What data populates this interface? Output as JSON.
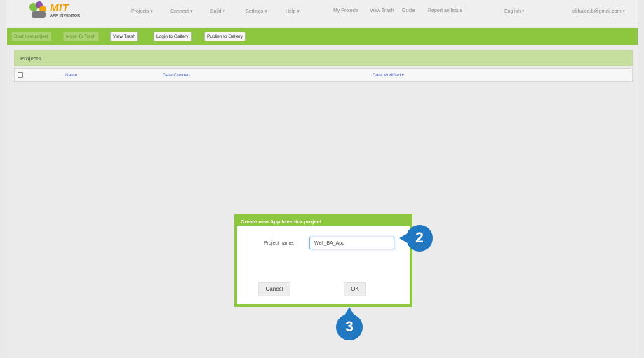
{
  "header": {
    "logo_title": "MIT",
    "logo_subtitle": "APP INVENTOR",
    "nav": [
      {
        "label": "Projects ▾"
      },
      {
        "label": "Connect ▾"
      },
      {
        "label": "Build ▾"
      },
      {
        "label": "Settings ▾"
      },
      {
        "label": "Help ▾"
      },
      {
        "label": "My Projects"
      },
      {
        "label": "View Trash"
      },
      {
        "label": "Guide"
      },
      {
        "label": "Report an Issue"
      },
      {
        "label": "English ▾"
      }
    ],
    "account": "qkhaled.b@gmail.com ▾"
  },
  "toolbar": {
    "buttons": [
      {
        "label": "Start new project"
      },
      {
        "label": "Move To Trash"
      },
      {
        "label": "View Trash"
      },
      {
        "label": "Login to Gallery"
      },
      {
        "label": "Publish to Gallery"
      }
    ]
  },
  "projects": {
    "title": "Projects",
    "columns": [
      "Name",
      "Date Created",
      "Date Modified▼"
    ]
  },
  "dialog": {
    "title": "Create new App Inventor project",
    "field_label": "Project name:",
    "field_value": "Well_BA_App",
    "cancel_label": "Cancel",
    "ok_label": "OK"
  },
  "callouts": [
    "2",
    "3"
  ],
  "colors": {
    "brand_green": "#8dc63f",
    "callout_blue": "#1f78c1",
    "link_blue": "#4a64b8"
  }
}
